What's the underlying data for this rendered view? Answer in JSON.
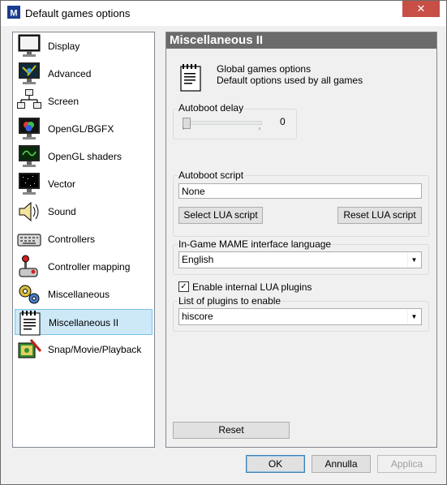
{
  "window": {
    "title": "Default games options",
    "close_label": "✕"
  },
  "categories": [
    {
      "label": "Display",
      "icon": "monitor-icon"
    },
    {
      "label": "Advanced",
      "icon": "advanced-monitor-icon"
    },
    {
      "label": "Screen",
      "icon": "screen-network-icon"
    },
    {
      "label": "OpenGL/BGFX",
      "icon": "opengl-icon"
    },
    {
      "label": "OpenGL shaders",
      "icon": "shaders-icon"
    },
    {
      "label": "Vector",
      "icon": "vector-icon"
    },
    {
      "label": "Sound",
      "icon": "speaker-icon"
    },
    {
      "label": "Controllers",
      "icon": "keyboard-icon"
    },
    {
      "label": "Controller mapping",
      "icon": "joystick-icon"
    },
    {
      "label": "Miscellaneous",
      "icon": "gears-icon"
    },
    {
      "label": "Miscellaneous II",
      "icon": "notepad-icon",
      "selected": true
    },
    {
      "label": "Snap/Movie/Playback",
      "icon": "snap-icon"
    }
  ],
  "panel": {
    "title": "Miscellaneous II",
    "info_line1": "Global games options",
    "info_line2": "Default options used by all games",
    "autoboot_delay": {
      "label": "Autoboot delay",
      "value": "0",
      "slider_fraction": 0
    },
    "autoboot_script": {
      "label": "Autoboot script",
      "value": "None",
      "select_button": "Select LUA script",
      "reset_button": "Reset LUA script"
    },
    "language": {
      "label": "In-Game MAME interface language",
      "value": "English"
    },
    "plugins": {
      "enable_label": "Enable internal LUA plugins",
      "enabled": true,
      "list_label": "List of plugins to enable",
      "value": "hiscore"
    },
    "reset_button": "Reset"
  },
  "footer": {
    "ok": "OK",
    "cancel": "Annulla",
    "apply": "Applica"
  }
}
